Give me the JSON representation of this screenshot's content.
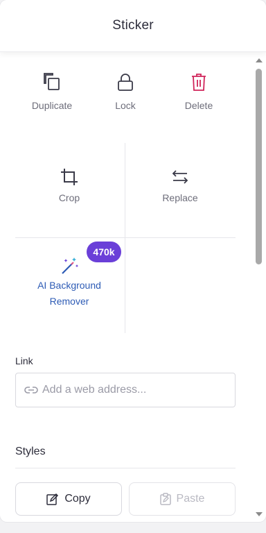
{
  "header": {
    "title": "Sticker"
  },
  "actions": [
    {
      "label": "Duplicate",
      "icon": "duplicate-icon"
    },
    {
      "label": "Lock",
      "icon": "lock-icon"
    },
    {
      "label": "Delete",
      "icon": "trash-icon",
      "color": "#d0245a"
    }
  ],
  "grid": {
    "crop": {
      "label": "Crop",
      "icon": "crop-icon"
    },
    "replace": {
      "label": "Replace",
      "icon": "swap-arrows-icon"
    },
    "ai_background": {
      "label_line1": "AI Background",
      "label_line2": "Remover",
      "icon": "magic-wand-icon",
      "badge": "470k",
      "badge_color": "#6a3fd8"
    }
  },
  "link": {
    "label": "Link",
    "placeholder": "Add a web address...",
    "icon": "link-icon"
  },
  "styles": {
    "label": "Styles",
    "copy_label": "Copy",
    "paste_label": "Paste"
  },
  "colors": {
    "accent": "#6a3fd8",
    "link_blue": "#2d5bb5",
    "delete_red": "#d0245a"
  }
}
